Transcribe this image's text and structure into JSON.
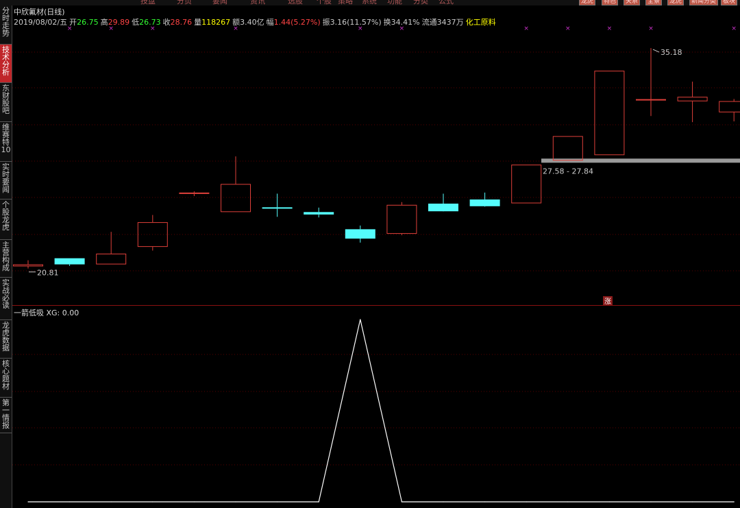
{
  "top_menu": [
    "技盘",
    "分页",
    "要闻",
    "资讯",
    "选股",
    "个股",
    "策略",
    "系统",
    "功能",
    "分类",
    "公式"
  ],
  "top_buttons": [
    "龙虎",
    "特色",
    "关系",
    "全景",
    "龙虎",
    "新闻分类",
    "板块"
  ],
  "sidebar": {
    "tabs": [
      {
        "label": "分时走势",
        "active": false
      },
      {
        "label": "技术分析",
        "active": true
      },
      {
        "label": "东财股吧",
        "active": false
      },
      {
        "label": "维赛特10",
        "active": false
      },
      {
        "label": "实时要闻",
        "active": false
      },
      {
        "label": "个股龙虎",
        "active": false
      },
      {
        "label": "主营构成",
        "active": false
      },
      {
        "label": "实战必读",
        "active": false
      },
      {
        "label": "龙虎数据",
        "active": false
      },
      {
        "label": "核心题材",
        "active": false
      },
      {
        "label": "第一情报",
        "active": false
      }
    ]
  },
  "stock": {
    "title": "中欣氟材(日线)",
    "date": "2019/08/02/五",
    "open_label": "开",
    "open": "26.75",
    "high_label": "高",
    "high": "29.89",
    "low_label": "低",
    "low": "26.73",
    "close_label": "收",
    "close": "28.76",
    "volume_label": "量",
    "volume": "118267",
    "amount_label": "额",
    "amount": "3.40亿",
    "change_label": "幅",
    "change": "1.44(5.27%)",
    "amplitude_label": "振",
    "amplitude": "3.16(11.57%)",
    "turnover_label": "换",
    "turnover": "34.41%",
    "float_label": "流通",
    "float": "3437万",
    "sector": "化工原料"
  },
  "indicator": {
    "name": "一箭低吸",
    "xg_label": "XG:",
    "xg_value": "0.00"
  },
  "colors": {
    "up": "#e0403a",
    "down": "#54fcfc",
    "marker": "#cc33cc",
    "grid": "#5a0000",
    "indicator_line": "#ffffff"
  },
  "chart_data": [
    {
      "type": "candlestick",
      "title": "中欣氟材(日线)",
      "ylim": [
        19.5,
        36.3
      ],
      "candles": [
        {
          "open": 20.95,
          "high": 21.35,
          "low": 20.81,
          "close": 21.08
        },
        {
          "open": 21.48,
          "high": 21.48,
          "low": 20.98,
          "close": 21.08
        },
        {
          "open": 21.08,
          "high": 23.2,
          "low": 21.08,
          "close": 21.78
        },
        {
          "open": 22.22,
          "high": 24.3,
          "low": 21.98,
          "close": 23.83
        },
        {
          "open": 25.69,
          "high": 25.84,
          "low": 25.53,
          "close": 25.76
        },
        {
          "open": 24.49,
          "high": 28.12,
          "low": 24.49,
          "close": 26.32
        },
        {
          "open": 24.8,
          "high": 25.69,
          "low": 24.18,
          "close": 24.79
        },
        {
          "open": 24.49,
          "high": 24.78,
          "low": 24.14,
          "close": 24.33
        },
        {
          "open": 23.37,
          "high": 23.61,
          "low": 22.5,
          "close": 22.76
        },
        {
          "open": 23.07,
          "high": 25.14,
          "low": 22.98,
          "close": 24.96
        },
        {
          "open": 25.04,
          "high": 25.69,
          "low": 24.55,
          "close": 24.54
        },
        {
          "open": 25.31,
          "high": 25.76,
          "low": 24.84,
          "close": 24.87
        },
        {
          "open": 25.06,
          "high": 27.58,
          "low": 25.06,
          "close": 27.58
        },
        {
          "open": 27.84,
          "high": 29.44,
          "low": 27.84,
          "close": 29.44
        },
        {
          "open": 28.2,
          "high": 33.7,
          "low": 28.2,
          "close": 33.7
        },
        {
          "open": 31.81,
          "high": 35.18,
          "low": 30.75,
          "close": 31.85
        },
        {
          "open": 31.71,
          "high": 32.99,
          "low": 30.35,
          "close": 32.0
        },
        {
          "open": 30.99,
          "high": 31.86,
          "low": 30.4,
          "close": 31.72
        }
      ],
      "annotations": {
        "low_label": "20.81",
        "high_label": "35.18",
        "gap_label": "27.58 - 27.84",
        "up_tag": "涨"
      },
      "markers_on_candles": [
        1,
        2,
        3,
        5,
        8,
        9,
        12,
        13,
        14,
        15,
        17
      ]
    },
    {
      "type": "line",
      "title": "一箭低吸",
      "series": [
        {
          "name": "XG",
          "values": [
            0,
            0,
            0,
            0,
            0,
            0,
            0,
            0,
            1,
            0,
            0,
            0,
            0,
            0,
            0,
            0,
            0,
            0
          ]
        }
      ],
      "ylim": [
        0,
        1
      ]
    }
  ]
}
